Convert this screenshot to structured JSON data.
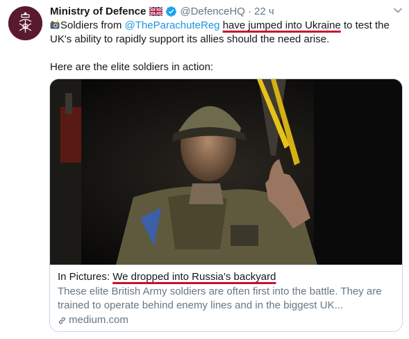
{
  "tweet": {
    "author_name": "Ministry of Defence",
    "author_handle": "@DefenceHQ",
    "separator": "·",
    "time": "22 ч",
    "text": {
      "prefix": "Soldiers from ",
      "mention": "@TheParachuteReg",
      "space": " ",
      "underlined": "have jumped into Ukraine",
      "suffix": " to test the UK's ability to rapidly support its allies should the need arise.",
      "second_paragraph": "Here are the elite soldiers in action:"
    },
    "icons": {
      "avatar": "mod-crest-icon",
      "flag": "uk-flag-icon",
      "verified": "verified-badge-icon",
      "caret": "chevron-down-icon",
      "camera": "camera-with-flash-icon",
      "link": "link-icon"
    }
  },
  "card": {
    "title_prefix": "In Pictures: ",
    "title_underlined": "We dropped into Russia's backyard",
    "description": "These elite British Army soldiers are often first into the battle. They are trained to operate behind enemy lines and in the biggest UK...",
    "domain": "medium.com"
  },
  "colors": {
    "link_blue": "#1b95e0",
    "verified_blue": "#1da1f2",
    "secondary_text": "#657786",
    "annotation_red": "#c7112d",
    "card_border": "#ccd6dd"
  }
}
